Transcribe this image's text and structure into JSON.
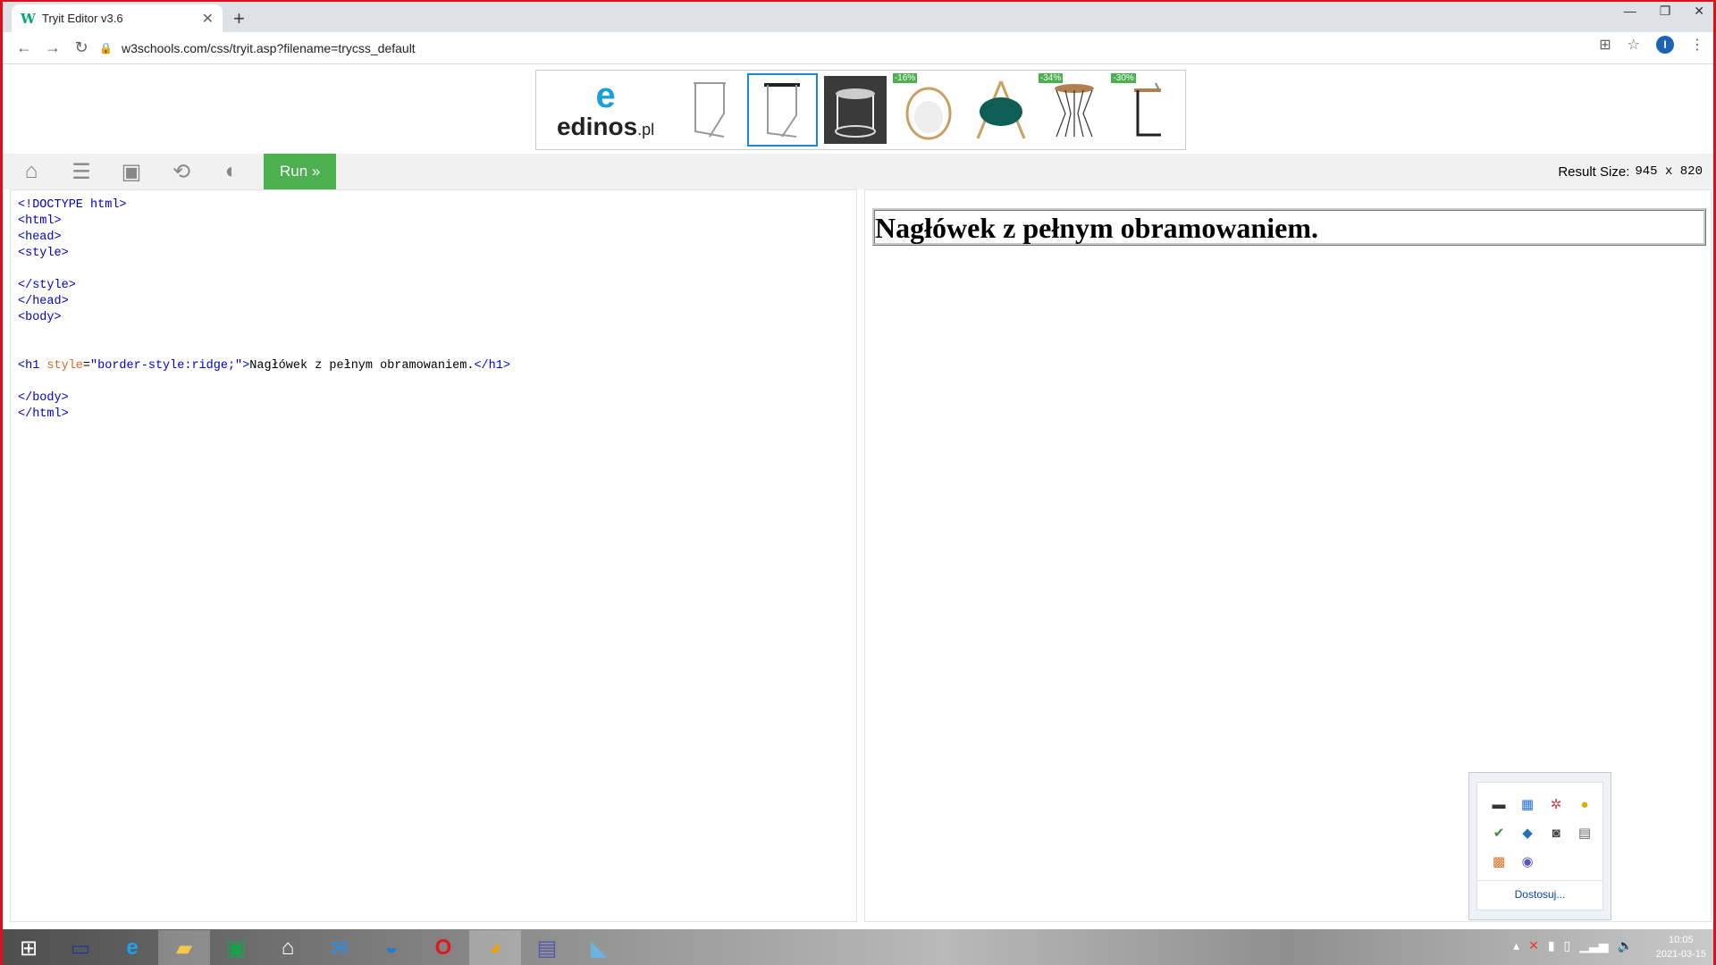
{
  "browser": {
    "tab_title": "Tryit Editor v3.6",
    "tab_favicon": "W",
    "close_glyph": "✕",
    "new_tab_glyph": "+",
    "url": "w3schools.com/css/tryit.asp?filename=trycss_default",
    "profile_initial": "I",
    "window_minimize": "—",
    "window_restore": "❐",
    "window_close": "✕"
  },
  "ad": {
    "logo_mark": "e",
    "logo_brand": "edinos",
    "logo_suffix": ".pl",
    "items": [
      {
        "discount": ""
      },
      {
        "discount": ""
      },
      {
        "discount": ""
      },
      {
        "discount": "-16%"
      },
      {
        "discount": ""
      },
      {
        "discount": "-34%"
      },
      {
        "discount": "-30%"
      }
    ]
  },
  "w3bar": {
    "run_label": "Run »",
    "result_size_label": "Result Size:",
    "result_size_value": "945 x 820"
  },
  "code": {
    "lines": [
      "<!DOCTYPE html>",
      "<html>",
      "<head>",
      "<style>",
      "",
      "</style>",
      "</head>",
      "<body>",
      "",
      "",
      "<h1 style=\"border-style:ridge;\">Nagłówek z pełnym obramowaniem.</h1>",
      "",
      "</body>",
      "</html>"
    ]
  },
  "result": {
    "heading": "Nagłówek z pełnym obramowaniem."
  },
  "tray": {
    "customize_label": "Dostosuj..."
  },
  "taskbar": {
    "time": "10:05",
    "date": "2021-03-15"
  },
  "colors": {
    "accent_green": "#4caf50",
    "frame_red": "#d8111c",
    "code_tag": "#0000cd",
    "code_attr": "#d2691e"
  }
}
